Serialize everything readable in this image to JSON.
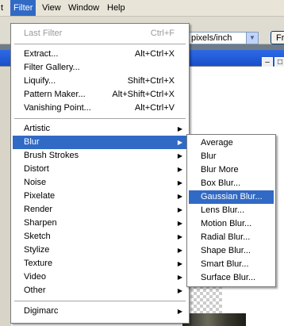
{
  "menubar": {
    "items": [
      {
        "label": "t"
      },
      {
        "label": "Filter"
      },
      {
        "label": "View"
      },
      {
        "label": "Window"
      },
      {
        "label": "Help"
      }
    ]
  },
  "options_bar": {
    "resolution_unit": "pixels/inch",
    "front_button": "Fr"
  },
  "filter_menu": {
    "last_filter": {
      "label": "Last Filter",
      "shortcut": "Ctrl+F"
    },
    "group1": [
      {
        "label": "Extract...",
        "shortcut": "Alt+Ctrl+X"
      },
      {
        "label": "Filter Gallery...",
        "shortcut": ""
      },
      {
        "label": "Liquify...",
        "shortcut": "Shift+Ctrl+X"
      },
      {
        "label": "Pattern Maker...",
        "shortcut": "Alt+Shift+Ctrl+X"
      },
      {
        "label": "Vanishing Point...",
        "shortcut": "Alt+Ctrl+V"
      }
    ],
    "group2": [
      {
        "label": "Artistic"
      },
      {
        "label": "Blur"
      },
      {
        "label": "Brush Strokes"
      },
      {
        "label": "Distort"
      },
      {
        "label": "Noise"
      },
      {
        "label": "Pixelate"
      },
      {
        "label": "Render"
      },
      {
        "label": "Sharpen"
      },
      {
        "label": "Sketch"
      },
      {
        "label": "Stylize"
      },
      {
        "label": "Texture"
      },
      {
        "label": "Video"
      },
      {
        "label": "Other"
      }
    ],
    "group3": [
      {
        "label": "Digimarc"
      }
    ],
    "highlighted": "Blur"
  },
  "blur_submenu": {
    "items": [
      {
        "label": "Average"
      },
      {
        "label": "Blur"
      },
      {
        "label": "Blur More"
      },
      {
        "label": "Box Blur..."
      },
      {
        "label": "Gaussian Blur..."
      },
      {
        "label": "Lens Blur..."
      },
      {
        "label": "Motion Blur..."
      },
      {
        "label": "Radial Blur..."
      },
      {
        "label": "Shape Blur..."
      },
      {
        "label": "Smart Blur..."
      },
      {
        "label": "Surface Blur..."
      }
    ],
    "highlighted": "Gaussian Blur..."
  },
  "colors": {
    "highlight": "#316ac5",
    "titlebar": "#2d6ae6",
    "menu_bg": "#ffffff"
  }
}
